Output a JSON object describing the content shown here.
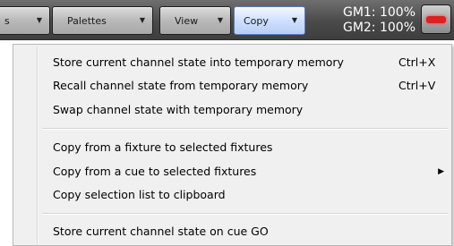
{
  "toolbar": {
    "prev_button_label": "s",
    "palettes_label": "Palettes",
    "view_label": "View",
    "copy_label": "Copy",
    "gm1": "GM1: 100%",
    "gm2": "GM2: 100%"
  },
  "menu": {
    "items": [
      {
        "label": "Store current channel state into temporary memory",
        "shortcut": "Ctrl+X"
      },
      {
        "label": "Recall channel state from temporary memory",
        "shortcut": "Ctrl+V"
      },
      {
        "label": "Swap channel state with temporary memory",
        "shortcut": ""
      },
      {
        "label": "Copy from a fixture to selected fixtures",
        "shortcut": ""
      },
      {
        "label": "Copy from a cue to selected fixtures",
        "shortcut": "",
        "submenu": true
      },
      {
        "label": "Copy selection list to clipboard",
        "shortcut": ""
      },
      {
        "label": "Store current channel state on cue GO",
        "shortcut": ""
      }
    ]
  },
  "colors": {
    "toolbar_bg": "#4a4a4a",
    "active_button": "#cfe0ff",
    "menu_bg": "#f0f0f0",
    "indicator_red": "#e01f1f"
  },
  "icons": {
    "dropdown": "chevron-down-icon",
    "submenu": "submenu-arrow-icon",
    "indicator": "red-led-icon"
  }
}
